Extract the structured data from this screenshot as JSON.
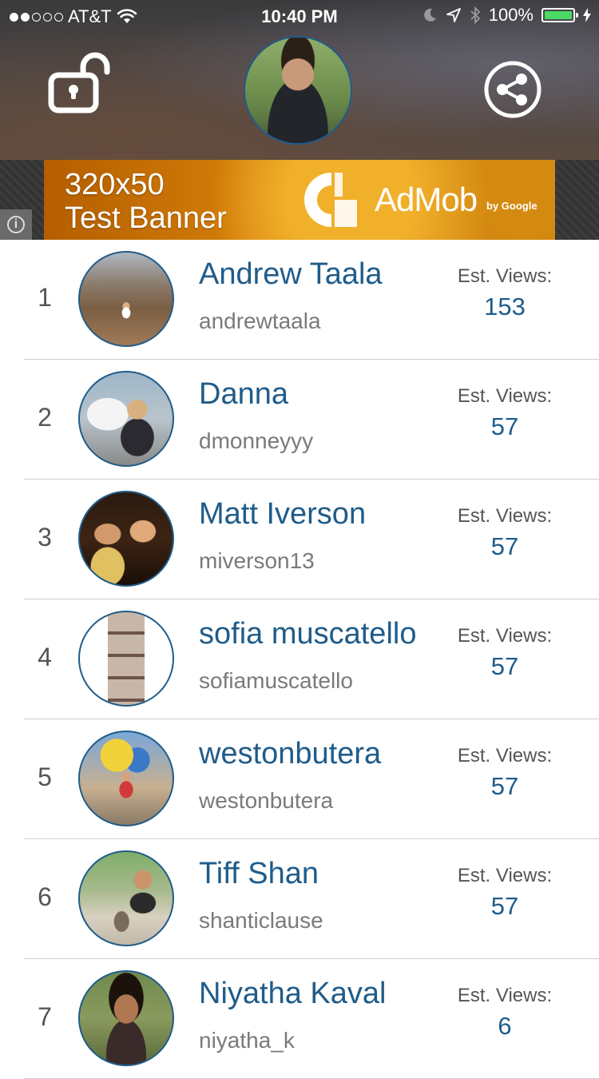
{
  "status_bar": {
    "carrier": "AT&T",
    "time": "10:40 PM",
    "battery": "100%",
    "signal_dots_filled": 2,
    "signal_dots_total": 5,
    "battery_color": "#4cd964"
  },
  "header": {
    "lock_icon": "unlocked-padlock-icon",
    "share_icon": "share-icon"
  },
  "ad": {
    "line1": "320x50",
    "line2": "Test Banner",
    "brand": "AdMob",
    "brand_sub": "by Google",
    "info_symbol": "i"
  },
  "colors": {
    "accent": "#1f5c8a",
    "subtext": "#7a7a7a",
    "ad_orange": "#e8a020"
  },
  "leaderboard": {
    "views_label": "Est. Views:",
    "entries": [
      {
        "rank": "1",
        "name": "Andrew Taala",
        "handle": "andrewtaala",
        "views": "153"
      },
      {
        "rank": "2",
        "name": "Danna",
        "handle": "dmonneyyy",
        "views": "57"
      },
      {
        "rank": "3",
        "name": "Matt Iverson",
        "handle": "miverson13",
        "views": "57"
      },
      {
        "rank": "4",
        "name": "sofia muscatello",
        "handle": "sofiamuscatello",
        "views": "57"
      },
      {
        "rank": "5",
        "name": "westonbutera",
        "handle": "westonbutera",
        "views": "57"
      },
      {
        "rank": "6",
        "name": "Tiff Shan",
        "handle": "shanticlause",
        "views": "57"
      },
      {
        "rank": "7",
        "name": "Niyatha Kaval",
        "handle": "niyatha_k",
        "views": "6"
      }
    ]
  }
}
